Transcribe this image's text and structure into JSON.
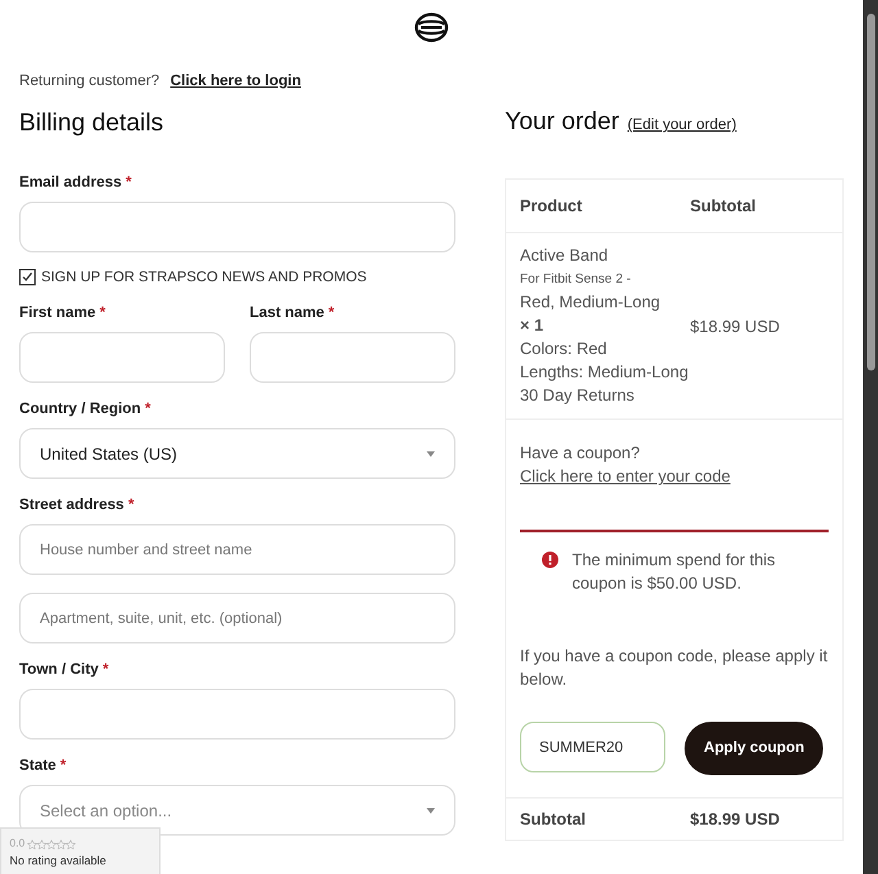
{
  "returning": {
    "text": "Returning customer?",
    "link": "Click here to login"
  },
  "billing": {
    "title": "Billing details",
    "fields": [
      {
        "kind": "input",
        "label": "Email address",
        "required_mark": "*"
      },
      {
        "kind": "checkbox",
        "label": "SIGN UP FOR STRAPSCO NEWS AND PROMOS",
        "checked": true
      },
      {
        "kind": "pair",
        "items": [
          {
            "label": "First name",
            "required_mark": "*"
          },
          {
            "label": "Last name",
            "required_mark": "*"
          }
        ]
      },
      {
        "kind": "select",
        "label": "Country / Region",
        "required_mark": "*",
        "value": "United States (US)"
      },
      {
        "kind": "input",
        "label": "Street address",
        "required_mark": "*",
        "placeholder": "House number and street name"
      },
      {
        "kind": "input",
        "placeholder": "Apartment, suite, unit, etc. (optional)"
      },
      {
        "kind": "input",
        "label": "Town / City",
        "required_mark": "*"
      },
      {
        "kind": "select",
        "label": "State",
        "required_mark": "*",
        "placeholder": "Select an option..."
      }
    ]
  },
  "order": {
    "title": "Your order",
    "edit_link": "(Edit your order)",
    "columns": [
      "Product",
      "Subtotal"
    ],
    "item": {
      "name": "Active Band",
      "variant": "For Fitbit Sense 2 -",
      "variant_detail": "Red, Medium-Long",
      "qty": "× 1",
      "meta": [
        "Colors: Red",
        "Lengths: Medium-Long",
        "30 Day Returns"
      ],
      "price": "$18.99 USD"
    },
    "coupon_prompt": "Have a coupon?",
    "coupon_link": "Click here to enter your code",
    "error": "The minimum spend for this coupon is $50.00 USD.",
    "coupon_hint": "If you have a coupon code, please apply it below.",
    "coupon_value": "SUMMER20",
    "apply": "Apply coupon",
    "subtotal_label": "Subtotal",
    "subtotal": "$18.99 USD"
  },
  "rating": {
    "score": "0.0",
    "stars": 0,
    "text": "No rating available"
  }
}
